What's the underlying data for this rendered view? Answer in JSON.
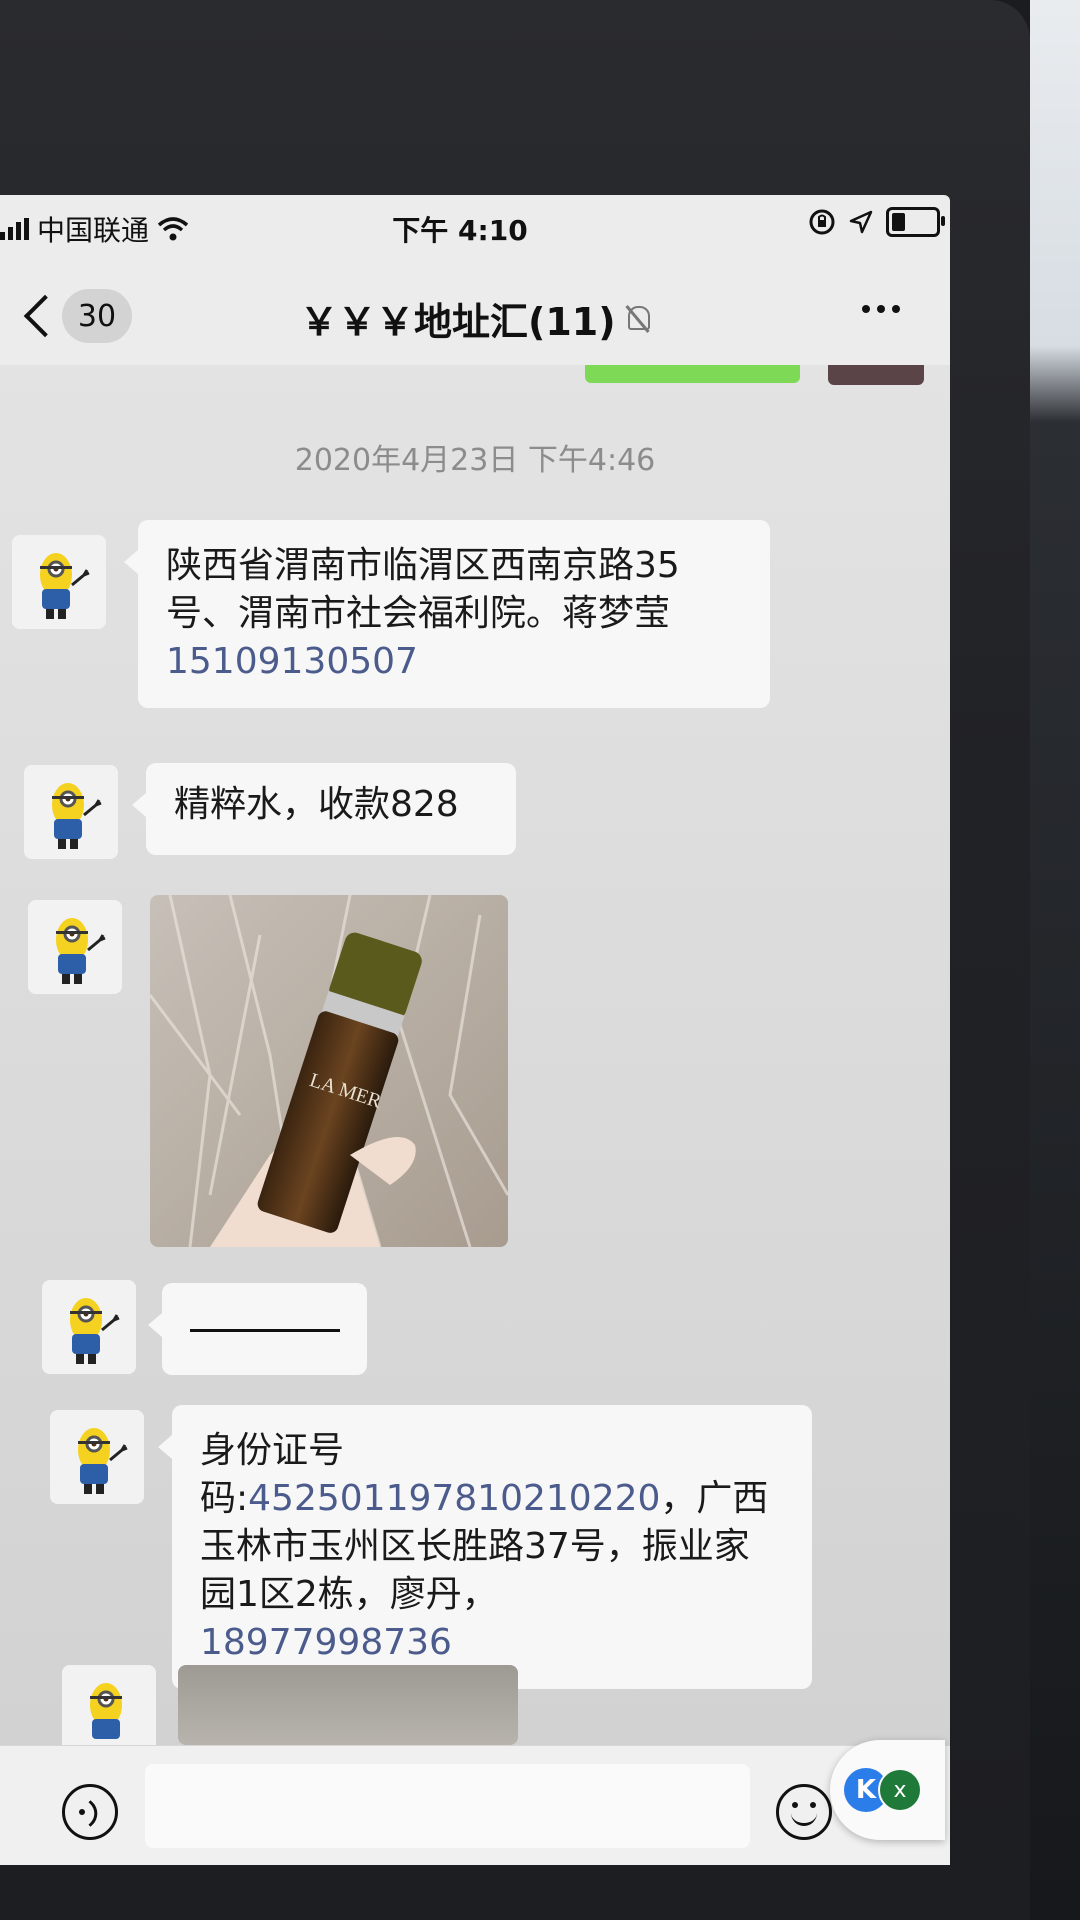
{
  "status_bar": {
    "carrier": "中国联通",
    "time": "下午 4:10",
    "battery_level": 0.35
  },
  "nav": {
    "back_count": "30",
    "title": "￥￥￥地址汇(11)",
    "muted": true
  },
  "chat": {
    "timestamp": "2020年4月23日 下午4:46",
    "messages": [
      {
        "type": "text",
        "text": "陕西省渭南市临渭区西南京路35号、渭南市社会福利院。蒋梦莹",
        "phone": "15109130507"
      },
      {
        "type": "text",
        "text": "精粹水，收款828"
      },
      {
        "type": "image",
        "brand_text": "LA MER"
      },
      {
        "type": "text",
        "text": ""
      },
      {
        "type": "text",
        "prefix": "身份证号码:",
        "id_number": "452501197810210220",
        "text": "，广西玉林市玉州区长胜路37号，振业家园1区2栋，廖丹，",
        "phone": "18977998736"
      },
      {
        "type": "image"
      }
    ]
  },
  "input_bar": {
    "placeholder": ""
  },
  "overlay": {
    "k_label": "K",
    "x_label": "x"
  },
  "colors": {
    "link": "#4b5b8c",
    "accent_green": "#7ed957",
    "bubble": "#f7f7f7"
  }
}
